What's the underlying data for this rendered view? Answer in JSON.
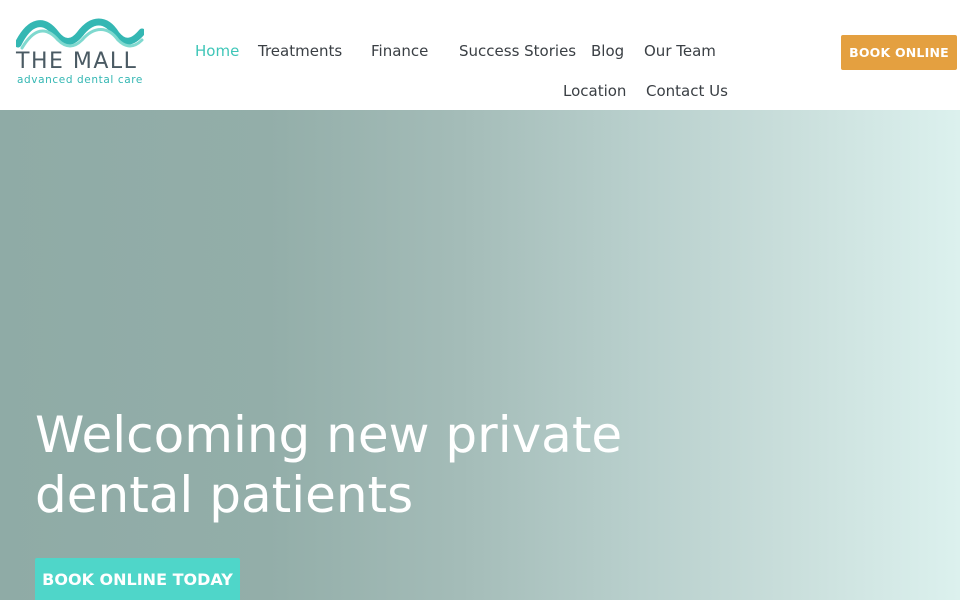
{
  "brand": {
    "name": "THE MALL",
    "tagline": "advanced dental care",
    "logo_colors": [
      "#34b7b3",
      "#7fd9cf"
    ]
  },
  "nav": {
    "items": [
      {
        "label": "Home",
        "active": true
      },
      {
        "label": "Treatments",
        "active": false
      },
      {
        "label": "Finance",
        "active": false
      },
      {
        "label": "Success Stories",
        "active": false
      },
      {
        "label": "Blog",
        "active": false
      },
      {
        "label": "Our Team",
        "active": false
      },
      {
        "label": "Location",
        "active": false
      },
      {
        "label": "Contact Us",
        "active": false
      }
    ],
    "active_color": "#3fc6b8"
  },
  "header_cta": {
    "label": "BOOK ONLINE",
    "color": "#e4a040"
  },
  "hero": {
    "title_line1": "Welcoming new private",
    "title_line2": "dental patients",
    "cta_label": "BOOK ONLINE TODAY",
    "cta_color": "#4fd6c9"
  }
}
